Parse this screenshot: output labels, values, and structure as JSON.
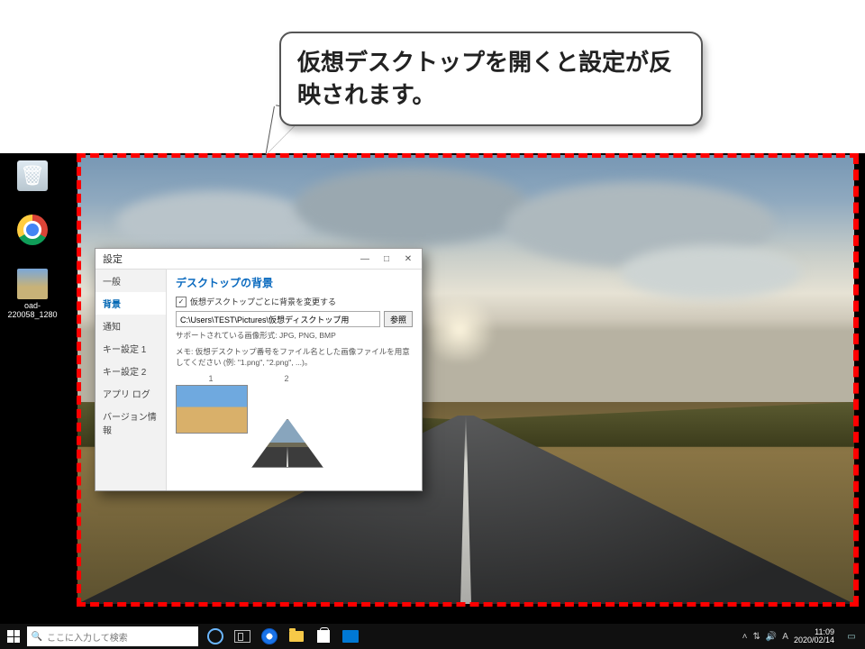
{
  "annotation": {
    "callout_text": "仮想デスクトップを開くと設定が反映されます。"
  },
  "desktop_icons": {
    "recycle_label": "",
    "chrome_label": "",
    "thumb_label": "oad-220058_1280"
  },
  "settings_window": {
    "title": "設定",
    "sidebar": {
      "items": [
        {
          "label": "一般"
        },
        {
          "label": "背景"
        },
        {
          "label": "通知"
        },
        {
          "label": "キー設定 1"
        },
        {
          "label": "キー設定 2"
        },
        {
          "label": "アプリ ログ"
        },
        {
          "label": "バージョン情報"
        }
      ],
      "selected_index": 1
    },
    "main": {
      "heading": "デスクトップの背景",
      "checkbox_label": "仮想デスクトップごとに背景を変更する",
      "checkbox_checked": true,
      "path_value": "C:\\Users\\TEST\\Pictures\\仮想ディスクトップ用",
      "browse_label": "参照",
      "hint_line1": "サポートされている画像形式: JPG, PNG, BMP",
      "hint_line2": "メモ: 仮想デスクトップ番号をファイル名とした画像ファイルを用意してください (例: \"1.png\", \"2.png\", ...)。",
      "thumbs": [
        {
          "num": "1"
        },
        {
          "num": "2"
        }
      ]
    },
    "win_buttons": {
      "min": "—",
      "max": "□",
      "close": "✕"
    }
  },
  "taskbar": {
    "search_placeholder": "ここに入力して検索",
    "clock_time": "11:09",
    "clock_date": "2020/02/14"
  }
}
